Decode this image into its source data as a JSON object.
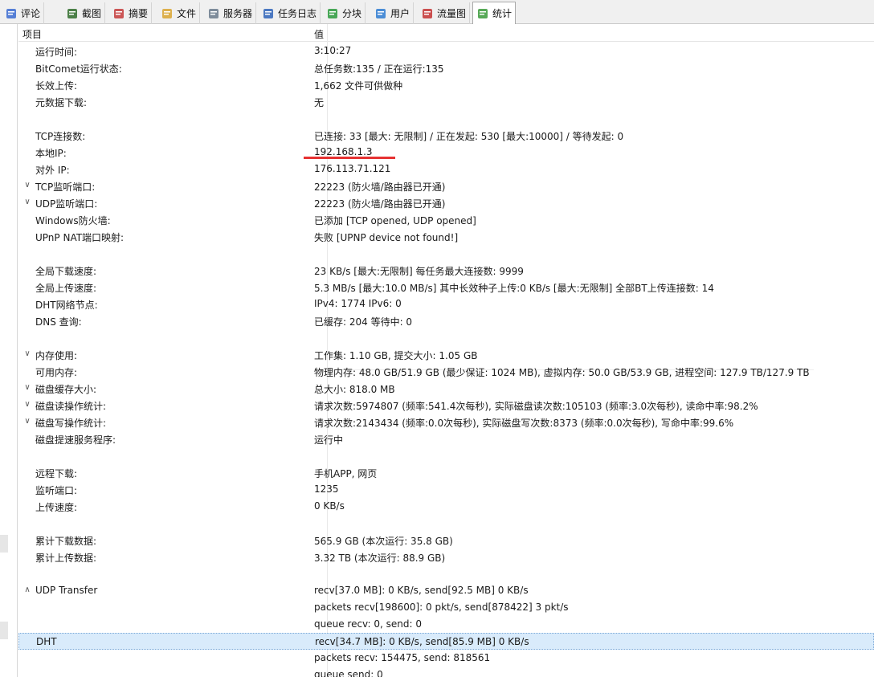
{
  "tabs": [
    {
      "label": "评论",
      "icon": "comment-icon"
    },
    {
      "label": "截图",
      "icon": "screenshot-icon"
    },
    {
      "label": "摘要",
      "icon": "summary-icon"
    },
    {
      "label": "文件",
      "icon": "folder-icon"
    },
    {
      "label": "服务器",
      "icon": "server-icon"
    },
    {
      "label": "任务日志",
      "icon": "log-icon"
    },
    {
      "label": "分块",
      "icon": "pie-chart-icon"
    },
    {
      "label": "用户",
      "icon": "user-icon"
    },
    {
      "label": "流量图",
      "icon": "line-chart-icon"
    },
    {
      "label": "统计",
      "icon": "stats-icon"
    }
  ],
  "active_tab": "统计",
  "header": {
    "col_item": "项目",
    "col_value": "值"
  },
  "rows": [
    {
      "key": "运行时间:",
      "value": "3:10:27",
      "expander": ""
    },
    {
      "key": "BitComet运行状态:",
      "value": "总任务数:135 / 正在运行:135",
      "expander": ""
    },
    {
      "key": "长效上传:",
      "value": "1,662 文件可供做种",
      "expander": ""
    },
    {
      "key": "元数据下载:",
      "value": "无",
      "expander": ""
    },
    {
      "key": "",
      "value": "",
      "expander": ""
    },
    {
      "key": "TCP连接数:",
      "value": "已连接: 33 [最大: 无限制] / 正在发起: 530 [最大:10000] / 等待发起: 0",
      "expander": ""
    },
    {
      "key": "本地IP:",
      "value": "192.168.1.3",
      "expander": ""
    },
    {
      "key": "对外 IP:",
      "value": "176.113.71.121",
      "expander": ""
    },
    {
      "key": "TCP监听端口:",
      "value": "22223 (防火墙/路由器已开通)",
      "expander": "∨"
    },
    {
      "key": "UDP监听端口:",
      "value": "22223 (防火墙/路由器已开通)",
      "expander": "∨"
    },
    {
      "key": "Windows防火墙:",
      "value": "已添加 [TCP opened, UDP opened]",
      "expander": ""
    },
    {
      "key": "UPnP NAT端口映射:",
      "value": "失败 [UPNP device not found!]",
      "expander": ""
    },
    {
      "key": "",
      "value": "",
      "expander": ""
    },
    {
      "key": "全局下载速度:",
      "value": "23 KB/s [最大:无限制]      每任务最大连接数: 9999",
      "expander": ""
    },
    {
      "key": "全局上传速度:",
      "value": "5.3 MB/s [最大:10.0 MB/s]      其中长效种子上传:0 KB/s [最大:无限制]      全部BT上传连接数: 14",
      "expander": ""
    },
    {
      "key": "DHT网络节点:",
      "value": "IPv4: 1774  IPv6: 0",
      "expander": ""
    },
    {
      "key": "DNS 查询:",
      "value": "已缓存:  204   等待中:  0",
      "expander": ""
    },
    {
      "key": "",
      "value": "",
      "expander": ""
    },
    {
      "key": "内存使用:",
      "value": "工作集: 1.10 GB, 提交大小: 1.05 GB",
      "expander": "∨"
    },
    {
      "key": "可用内存:",
      "value": "物理内存: 48.0 GB/51.9 GB (最少保证: 1024 MB), 虚拟内存: 50.0 GB/53.9 GB, 进程空间: 127.9 TB/127.9 TB",
      "expander": ""
    },
    {
      "key": "磁盘缓存大小:",
      "value": "总大小:  818.0 MB",
      "expander": "∨"
    },
    {
      "key": "磁盘读操作统计:",
      "value": "请求次数:5974807 (频率:541.4次每秒), 实际磁盘读次数:105103 (频率:3.0次每秒), 读命中率:98.2%",
      "expander": "∨"
    },
    {
      "key": "磁盘写操作统计:",
      "value": "请求次数:2143434 (频率:0.0次每秒), 实际磁盘写次数:8373 (频率:0.0次每秒), 写命中率:99.6%",
      "expander": "∨"
    },
    {
      "key": "磁盘提速服务程序:",
      "value": "运行中",
      "expander": ""
    },
    {
      "key": "",
      "value": "",
      "expander": ""
    },
    {
      "key": "远程下载:",
      "value": "手机APP, 网页",
      "expander": ""
    },
    {
      "key": "监听端口:",
      "value": "1235",
      "expander": ""
    },
    {
      "key": "上传速度:",
      "value": "0 KB/s",
      "expander": ""
    },
    {
      "key": "",
      "value": "",
      "expander": ""
    },
    {
      "key": "累计下载数据:",
      "value": "565.9 GB (本次运行: 35.8 GB)",
      "expander": ""
    },
    {
      "key": "累计上传数据:",
      "value": "3.32 TB (本次运行: 88.9 GB)",
      "expander": ""
    },
    {
      "key": "",
      "value": "",
      "expander": ""
    },
    {
      "key": "UDP Transfer",
      "value": "recv[37.0 MB]: 0 KB/s, send[92.5 MB] 0 KB/s",
      "expander": "∧"
    },
    {
      "key": "",
      "value": "packets recv[198600]: 0 pkt/s, send[878422] 3 pkt/s",
      "expander": ""
    },
    {
      "key": "",
      "value": "queue recv: 0, send: 0",
      "expander": ""
    },
    {
      "key": "DHT",
      "value": "recv[34.7 MB]: 0 KB/s, send[85.9 MB] 0 KB/s",
      "expander": "",
      "selected": true
    },
    {
      "key": "",
      "value": "packets recv: 154475, send: 818561",
      "expander": ""
    },
    {
      "key": "",
      "value": "queue send: 0",
      "expander": ""
    }
  ],
  "colors": {
    "highlight_line": "#e63232",
    "selection": "#d9ebfb"
  }
}
